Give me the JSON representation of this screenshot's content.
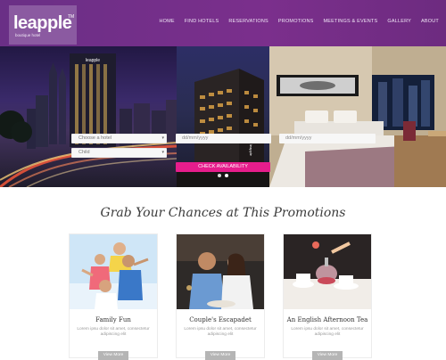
{
  "header": {
    "logo_text": "leapple",
    "logo_tm": "TM",
    "logo_sub": "boutique hotel",
    "nav": [
      "HOME",
      "FIND HOTELS",
      "RESERVATIONS",
      "PROMOTIONS",
      "MEETINGS & EVENTS",
      "GALLERY",
      "ABOUT"
    ]
  },
  "booking": {
    "hotel_select": "Choose a hotel",
    "child_select": "Child",
    "checkin_placeholder": "dd/mm/yyyy",
    "checkout_placeholder": "dd/mm/yyyy",
    "check_button": "CHECK AVAILABILITY"
  },
  "hero": {
    "building_sign": "leapple",
    "building_sign_2": "leapple"
  },
  "promotions": {
    "heading": "Grab Your Chances at This Promotions",
    "cards": [
      {
        "title": "Family Fun",
        "text": "Lorem ipsu dolor sit amet, consectetur adipiscing elit",
        "button": "View More"
      },
      {
        "title": "Couple's Escapadet",
        "text": "Lorem ipsu dolor sit amet, consectetur adipiscing elit",
        "button": "View More"
      },
      {
        "title": "An English Afternoon Tea",
        "text": "Lorem ipsu dolor sit amet, consectetur adipiscing elit",
        "button": "View More"
      }
    ]
  },
  "colors": {
    "header": "#7b2f8c",
    "accent": "#e61d8c"
  }
}
